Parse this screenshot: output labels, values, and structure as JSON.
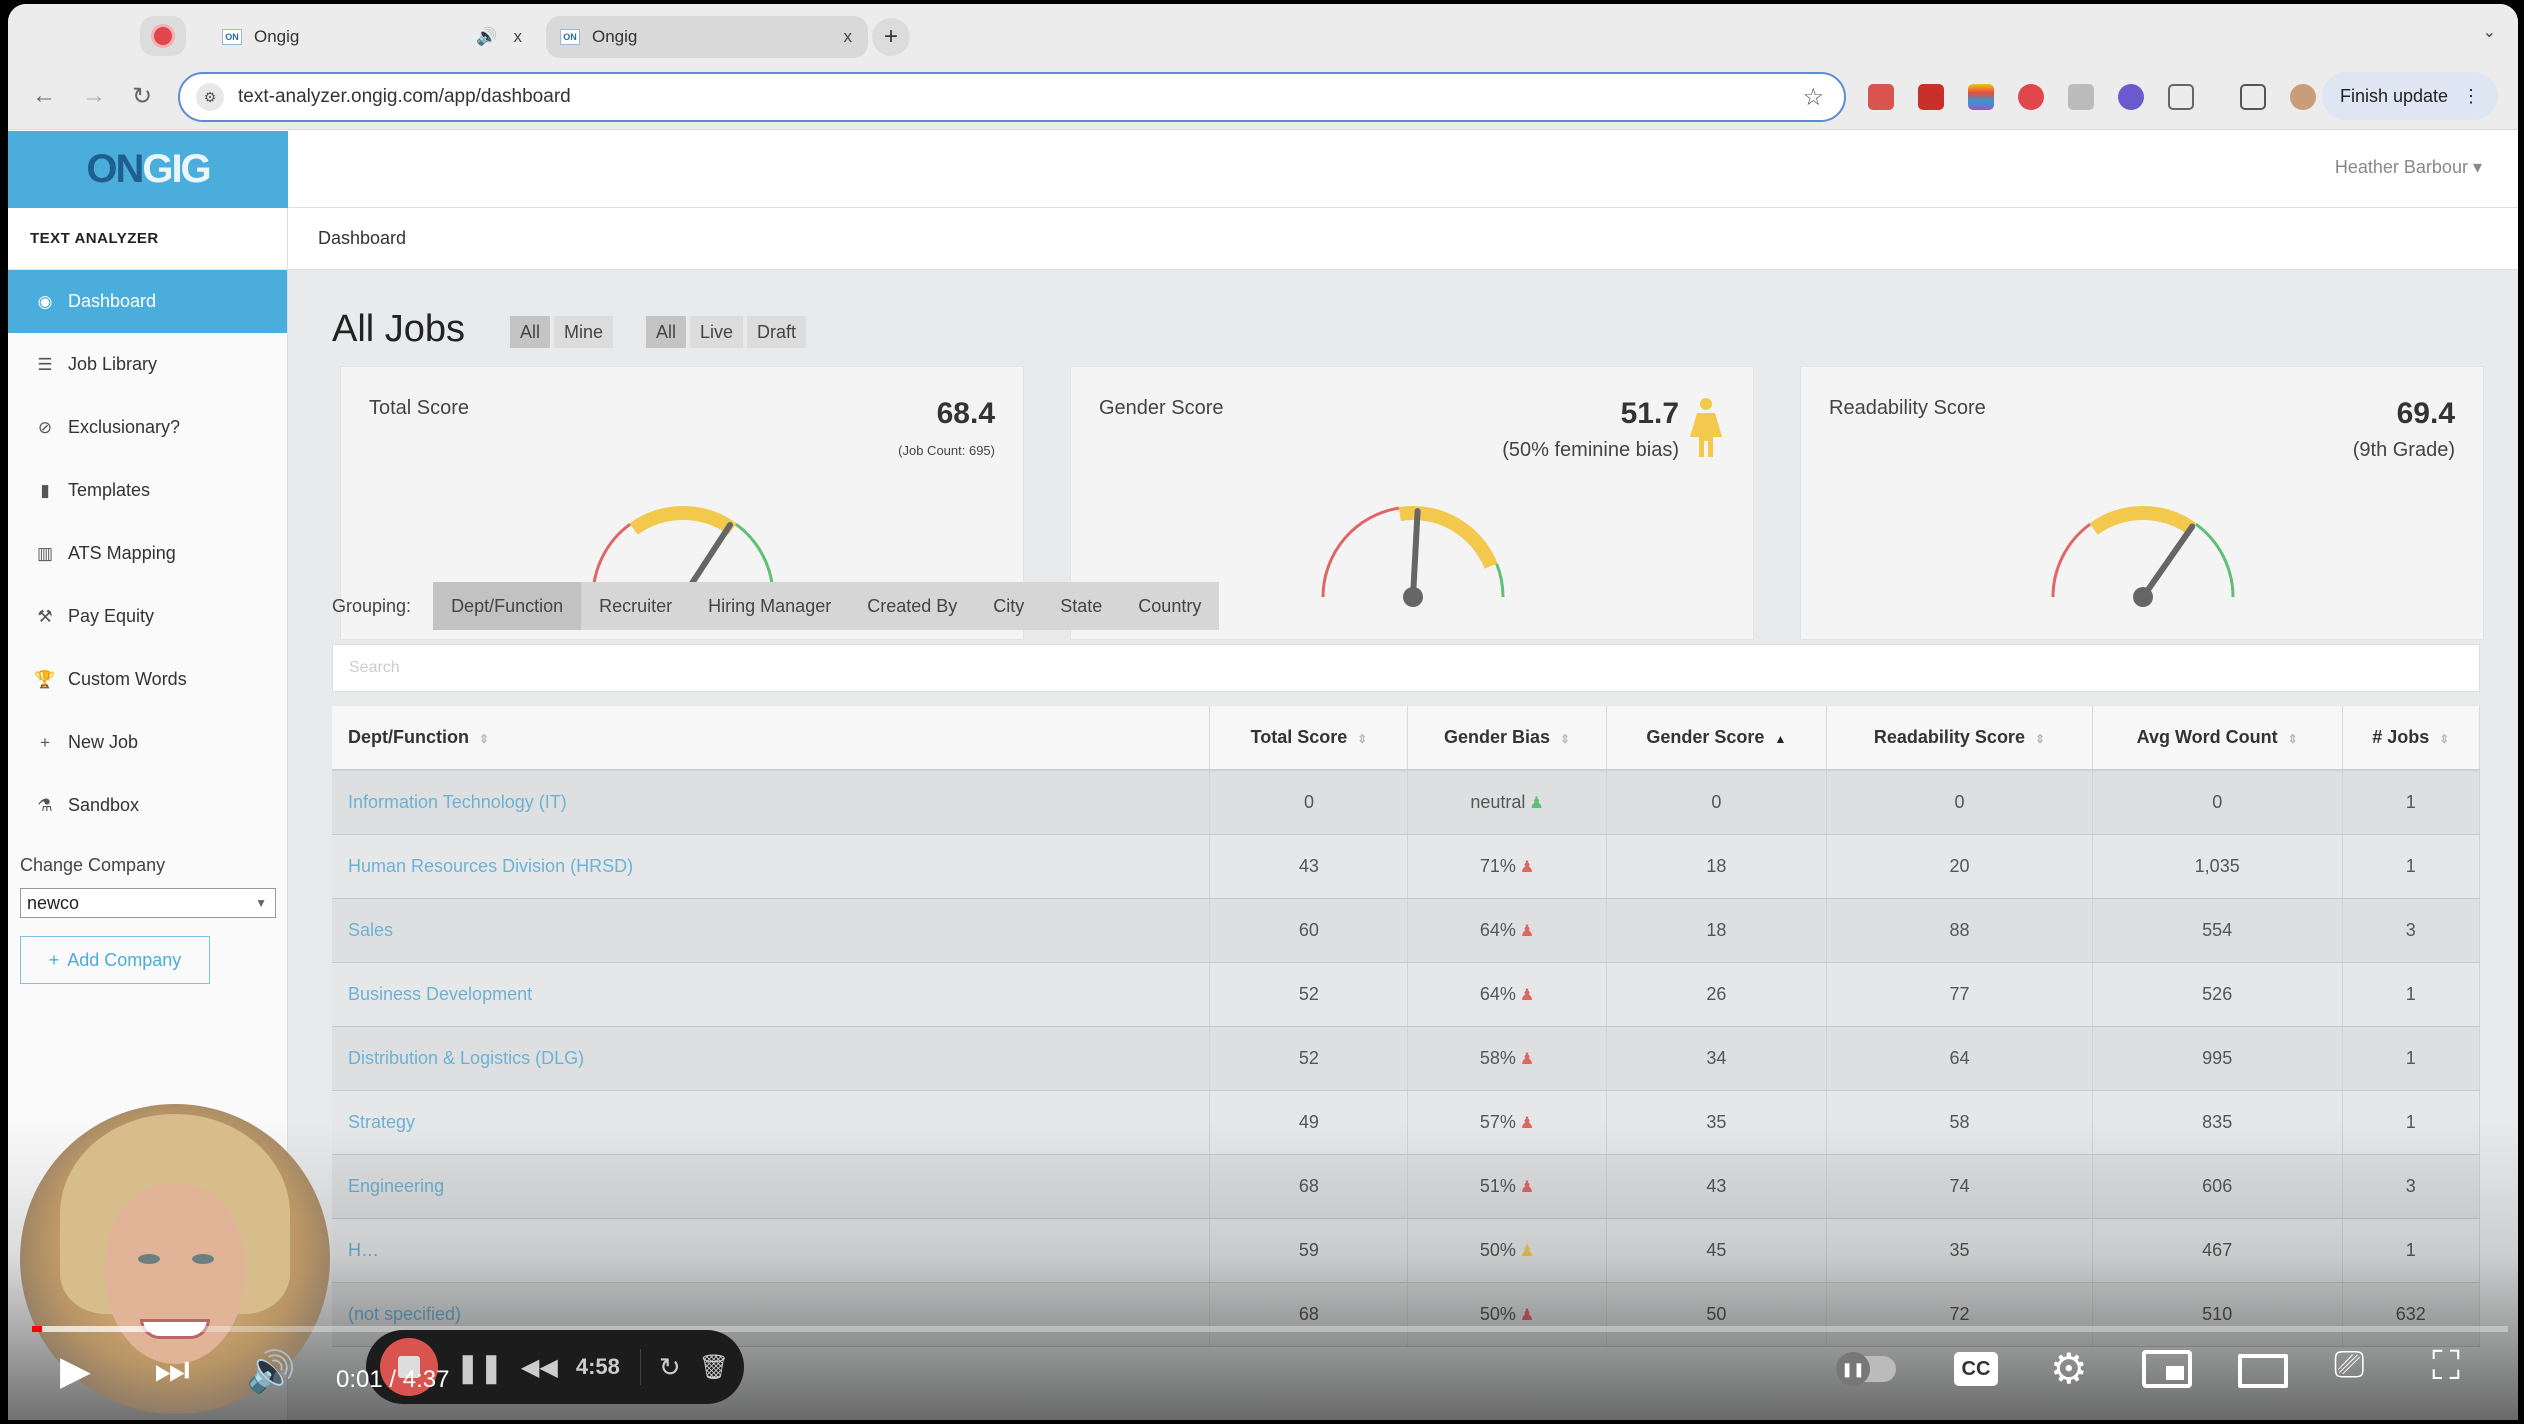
{
  "browser": {
    "tabs": [
      {
        "favicon": "ON",
        "title": "Ongig",
        "audio_icon": "speaker-icon",
        "close": "x"
      },
      {
        "favicon": "ON",
        "title": "Ongig",
        "close": "x"
      }
    ],
    "new_tab": "+",
    "tab_menu": "⌄",
    "nav": {
      "back": "←",
      "forward": "→",
      "reload": "↻"
    },
    "url": "text-analyzer.ongig.com/app/dashboard",
    "bookmark": "☆",
    "finish_update": "Finish update",
    "menu": "⋮"
  },
  "app": {
    "logo_on": "ON",
    "logo_gig": "GIG",
    "user": "Heather Barbour ▾",
    "section_heading": "TEXT ANALYZER",
    "breadcrumb": "Dashboard",
    "colors": {
      "brand": "#4aaddb",
      "link": "#6bb3d6",
      "danger": "#e06666",
      "warning": "#f2c94c",
      "success": "#5fbf72"
    }
  },
  "sidebar": {
    "items": [
      {
        "label": "Dashboard",
        "icon": "◉",
        "active": true
      },
      {
        "label": "Job Library",
        "icon": "☰"
      },
      {
        "label": "Exclusionary?",
        "icon": "⊘"
      },
      {
        "label": "Templates",
        "icon": "▮"
      },
      {
        "label": "ATS Mapping",
        "icon": "▥"
      },
      {
        "label": "Pay Equity",
        "icon": "⚒"
      },
      {
        "label": "Custom Words",
        "icon": "🏆"
      },
      {
        "label": "New Job",
        "icon": "+"
      },
      {
        "label": "Sandbox",
        "icon": "⚗"
      }
    ],
    "change_company_label": "Change Company",
    "company_selected": "newco",
    "add_company": "Add Company"
  },
  "main": {
    "title": "All Jobs",
    "owner_filter": [
      {
        "label": "All",
        "selected": true
      },
      {
        "label": "Mine"
      }
    ],
    "status_filter": [
      {
        "label": "All",
        "selected": true
      },
      {
        "label": "Live"
      },
      {
        "label": "Draft"
      }
    ],
    "cards": [
      {
        "label": "Total Score",
        "value": "68.4",
        "sub": "(Job Count: 695)",
        "gauge_value": 68.4
      },
      {
        "label": "Gender Score",
        "value": "51.7",
        "sub": "(50% feminine bias)",
        "gauge_value": 51.7,
        "icon": "female-figure-icon"
      },
      {
        "label": "Readability Score",
        "value": "69.4",
        "sub": "(9th Grade)",
        "gauge_value": 69.4
      }
    ],
    "grouping_label": "Grouping:",
    "grouping_tabs": [
      {
        "label": "Dept/Function",
        "selected": true
      },
      {
        "label": "Recruiter"
      },
      {
        "label": "Hiring Manager"
      },
      {
        "label": "Created By"
      },
      {
        "label": "City"
      },
      {
        "label": "State"
      },
      {
        "label": "Country"
      }
    ],
    "search_placeholder": "Search",
    "table": {
      "columns": [
        "Dept/Function",
        "Total Score",
        "Gender Bias",
        "Gender Score",
        "Readability Score",
        "Avg Word Count",
        "# Jobs"
      ],
      "sorted_column": "Gender Score",
      "rows": [
        {
          "dept": "Information Technology (IT)",
          "total": "0",
          "bias": "neutral",
          "bias_color": "#5fbf72",
          "gender": "0",
          "read": "0",
          "words": "0",
          "jobs": "1"
        },
        {
          "dept": "Human Resources Division (HRSD)",
          "total": "43",
          "bias": "71%",
          "bias_color": "#e06666",
          "gender": "18",
          "read": "20",
          "words": "1,035",
          "jobs": "1"
        },
        {
          "dept": "Sales",
          "total": "60",
          "bias": "64%",
          "bias_color": "#e06666",
          "gender": "18",
          "read": "88",
          "words": "554",
          "jobs": "3"
        },
        {
          "dept": "Business Development",
          "total": "52",
          "bias": "64%",
          "bias_color": "#e06666",
          "gender": "26",
          "read": "77",
          "words": "526",
          "jobs": "1"
        },
        {
          "dept": "Distribution & Logistics (DLG)",
          "total": "52",
          "bias": "58%",
          "bias_color": "#e06666",
          "gender": "34",
          "read": "64",
          "words": "995",
          "jobs": "1"
        },
        {
          "dept": "Strategy",
          "total": "49",
          "bias": "57%",
          "bias_color": "#e06666",
          "gender": "35",
          "read": "58",
          "words": "835",
          "jobs": "1"
        },
        {
          "dept": "Engineering",
          "total": "68",
          "bias": "51%",
          "bias_color": "#e06666",
          "gender": "43",
          "read": "74",
          "words": "606",
          "jobs": "3"
        },
        {
          "dept": "H…",
          "total": "59",
          "bias": "50%",
          "bias_color": "#f2c94c",
          "gender": "45",
          "read": "35",
          "words": "467",
          "jobs": "1"
        },
        {
          "dept": "(not specified)",
          "total": "68",
          "bias": "50%",
          "bias_color": "#e06666",
          "gender": "50",
          "read": "72",
          "words": "510",
          "jobs": "632"
        }
      ]
    }
  },
  "video_player": {
    "current_time": "0:01",
    "duration": "4:37",
    "time_display": "0:01 / 4:37",
    "progress_fraction": 0.004,
    "buffer_fraction": 0.065,
    "controls": [
      "play",
      "next",
      "volume",
      "autoplay",
      "captions",
      "settings",
      "miniplayer",
      "theater",
      "cast",
      "fullscreen"
    ],
    "cc_label": "CC"
  },
  "recorder": {
    "elapsed": "4:58"
  }
}
